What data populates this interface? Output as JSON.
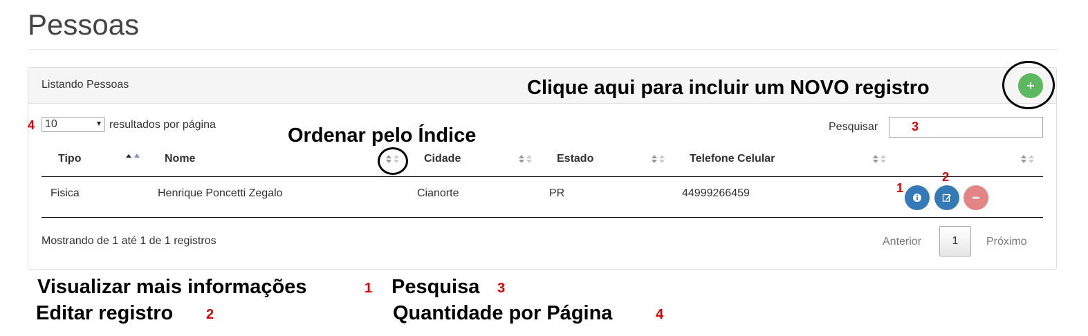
{
  "page": {
    "title": "Pessoas"
  },
  "panel": {
    "title": "Listando Pessoas",
    "add_note": "Clique aqui para incluir um NOVO registro"
  },
  "controls": {
    "length_value": "10",
    "length_label": "resultados por página",
    "search_label": "Pesquisar",
    "search_value": ""
  },
  "annotations": {
    "order_note": "Ordenar pelo Índice",
    "markers": {
      "one": "1",
      "two": "2",
      "three": "3",
      "four": "4"
    }
  },
  "table": {
    "columns": [
      "Tipo",
      "Nome",
      "Cidade",
      "Estado",
      "Telefone Celular"
    ],
    "rows": [
      {
        "tipo": "Fisica",
        "nome": "Henrique Poncetti Zegalo",
        "cidade": "Cianorte",
        "estado": "PR",
        "telefone": "44999266459"
      }
    ]
  },
  "footer": {
    "info": "Mostrando de 1 até 1 de 1 registros",
    "prev": "Anterior",
    "page": "1",
    "next": "Próximo"
  },
  "legend": {
    "view": "Visualizar mais informações",
    "edit": "Editar registro",
    "search": "Pesquisa",
    "per_page": "Quantidade por Página"
  },
  "colors": {
    "add": "#5cb85c",
    "primary": "#337ab7",
    "danger": "#e38585",
    "marker": "#e00000"
  },
  "icons": [
    "plus-icon",
    "sort-icon",
    "sort-asc-icon",
    "info-icon",
    "edit-icon",
    "minus-icon"
  ]
}
